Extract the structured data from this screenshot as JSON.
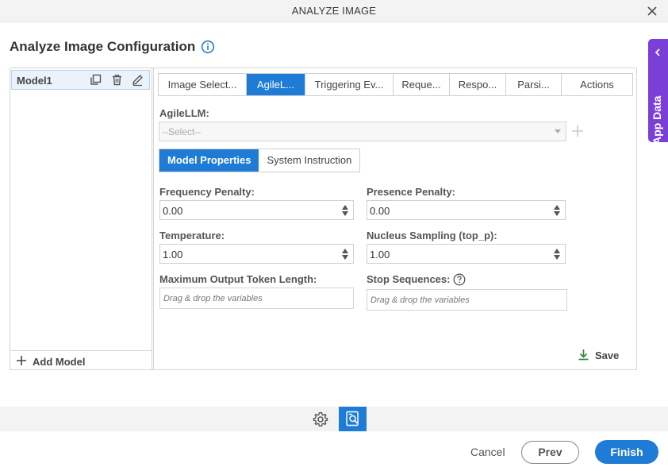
{
  "window": {
    "title": "ANALYZE IMAGE"
  },
  "page": {
    "title": "Analyze Image Configuration"
  },
  "app_data": {
    "label": "App Data"
  },
  "models": {
    "items": [
      {
        "name": "Model1"
      }
    ],
    "add_label": "Add Model"
  },
  "tabs": [
    {
      "label": "Image Select...",
      "active": false
    },
    {
      "label": "AgileL...",
      "active": true
    },
    {
      "label": "Triggering Ev...",
      "active": false
    },
    {
      "label": "Reque...",
      "active": false
    },
    {
      "label": "Respo...",
      "active": false
    },
    {
      "label": "Parsi...",
      "active": false
    },
    {
      "label": "Actions",
      "active": false
    }
  ],
  "agilellm": {
    "label": "AgileLLM:",
    "selected": "--Select--"
  },
  "subtabs": [
    {
      "label": "Model Properties",
      "active": true
    },
    {
      "label": "System Instruction",
      "active": false
    }
  ],
  "fields": {
    "frequency_penalty": {
      "label": "Frequency Penalty:",
      "value": "0.00"
    },
    "presence_penalty": {
      "label": "Presence Penalty:",
      "value": "0.00"
    },
    "temperature": {
      "label": "Temperature:",
      "value": "1.00"
    },
    "nucleus_sampling": {
      "label": "Nucleus Sampling (top_p):",
      "value": "1.00"
    },
    "max_output_tokens": {
      "label": "Maximum Output Token Length:",
      "placeholder": "Drag & drop the variables"
    },
    "stop_sequences": {
      "label": "Stop Sequences:",
      "placeholder": "Drag & drop the variables"
    }
  },
  "save_label": "Save",
  "footer": {
    "cancel": "Cancel",
    "prev": "Prev",
    "finish": "Finish"
  },
  "colors": {
    "accent": "#1f7cd6",
    "app_data_tab": "#7a3fd6",
    "save_icon": "#2e8b3a"
  }
}
